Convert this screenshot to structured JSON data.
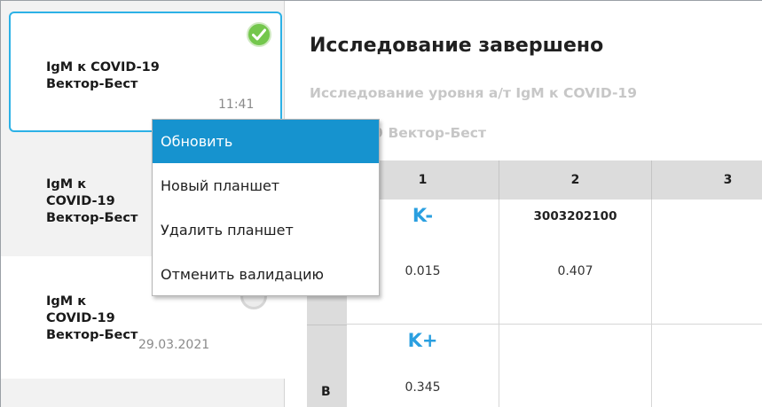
{
  "sidebar": {
    "plates": [
      {
        "title_line1": "IgM к COVID-19",
        "title_line2": "Вектор-Бест",
        "time": "11:41",
        "status_icon": "check-circle-icon"
      },
      {
        "title_line1": "IgM к",
        "title_line2": "COVID-19",
        "title_line3": "Вектор-Бест"
      },
      {
        "title_line1": "IgM к",
        "title_line2": "COVID-19",
        "title_line3": "Вектор-Бест",
        "date": "29.03.2021"
      }
    ]
  },
  "context_menu": {
    "items": [
      "Обновить",
      "Новый планшет",
      "Удалить планшет",
      "Отменить валидацию"
    ],
    "active_index": 0
  },
  "main": {
    "status_title": "Исследование завершено",
    "subtitle": "Исследование уровня а/т IgM к COVID-19",
    "subtitle2": "COVID-19 Вектор-Бест",
    "grid": {
      "columns": [
        "1",
        "2",
        "3"
      ],
      "rows": [
        {
          "label": "",
          "cells": [
            {
              "label": "K-",
              "value": "0.015"
            },
            {
              "code": "3003202100",
              "value": "0.407"
            },
            {}
          ]
        },
        {
          "label": "B",
          "cells": [
            {
              "label": "K+",
              "value": "0.345"
            },
            {},
            {}
          ]
        }
      ]
    }
  },
  "colors": {
    "accent": "#1693cf",
    "selected_border": "#2cb1e6",
    "control_label": "#2a9fe0",
    "success": "#74c74d"
  }
}
